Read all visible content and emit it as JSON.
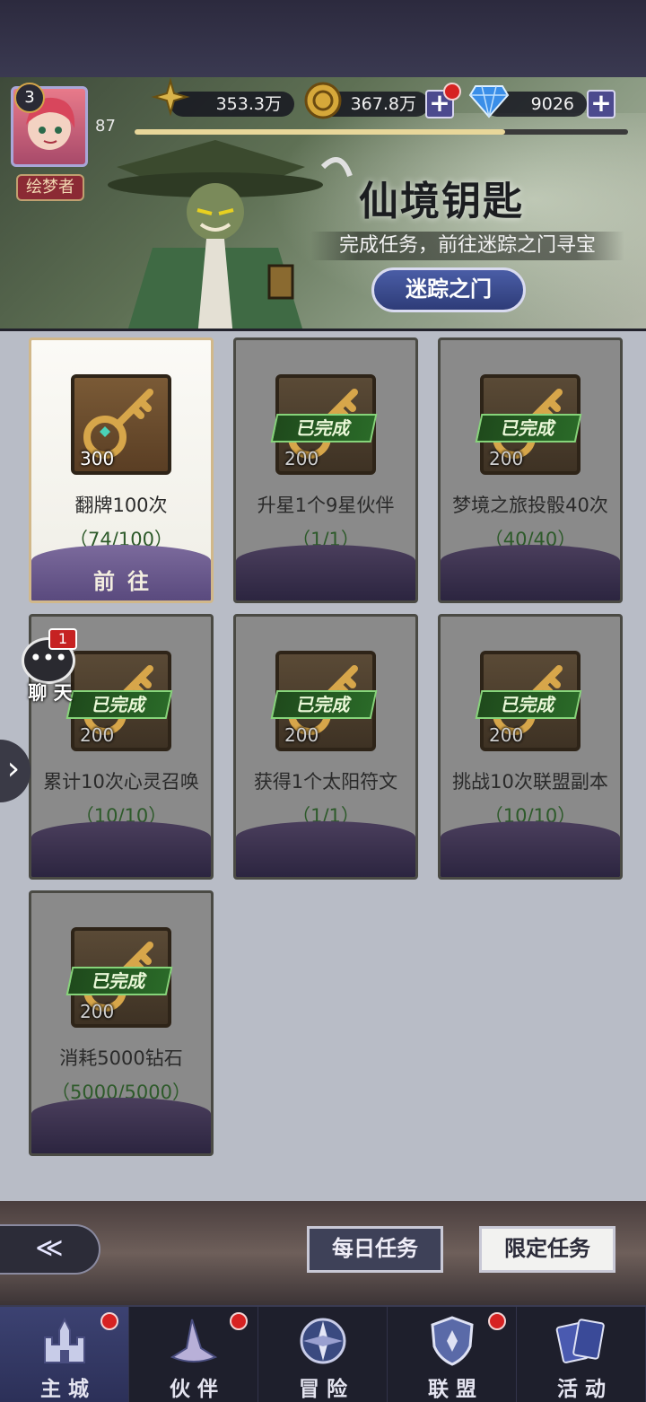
{
  "resources": {
    "power": "353.3万",
    "gold": "367.8万",
    "diamonds": "9026"
  },
  "player": {
    "level_badge": "3",
    "level": "87",
    "title": "绘梦者",
    "xp_fraction": 0.75
  },
  "event": {
    "title": "仙境钥匙",
    "subtitle": "完成任务，前往迷踪之门寻宝",
    "portal_button": "迷踪之门"
  },
  "tasks": [
    {
      "title": "翻牌100次",
      "progress": "（74/100）",
      "reward": "300",
      "status": "active",
      "action": "前往"
    },
    {
      "title": "升星1个9星伙伴",
      "progress": "（1/1）",
      "reward": "200",
      "status": "done",
      "stamp": "已完成"
    },
    {
      "title": "梦境之旅投骰40次",
      "progress": "（40/40）",
      "reward": "200",
      "status": "done",
      "stamp": "已完成"
    },
    {
      "title": "累计10次心灵召唤",
      "progress": "（10/10）",
      "reward": "200",
      "status": "done",
      "stamp": "已完成"
    },
    {
      "title": "获得1个太阳符文",
      "progress": "（1/1）",
      "reward": "200",
      "status": "done",
      "stamp": "已完成"
    },
    {
      "title": "挑战10次联盟副本",
      "progress": "（10/10）",
      "reward": "200",
      "status": "done",
      "stamp": "已完成"
    },
    {
      "title": "消耗5000钻石",
      "progress": "（5000/5000）",
      "reward": "200",
      "status": "done",
      "stamp": "已完成"
    }
  ],
  "chat": {
    "label": "聊 天",
    "badge": "1"
  },
  "task_tabs": {
    "daily": "每日任务",
    "limited": "限定任务"
  },
  "nav": [
    {
      "label": "主城",
      "icon": "castle-icon",
      "active": true,
      "dot": true
    },
    {
      "label": "伙伴",
      "icon": "wizard-hat-icon",
      "active": false,
      "dot": true
    },
    {
      "label": "冒险",
      "icon": "compass-icon",
      "active": false,
      "dot": false
    },
    {
      "label": "联盟",
      "icon": "shield-icon",
      "active": false,
      "dot": true
    },
    {
      "label": "活动",
      "icon": "cards-icon",
      "active": false,
      "dot": false
    }
  ],
  "colors": {
    "accent": "#4a5da6",
    "done_green": "#2a6a28",
    "badge_red": "#d62222"
  }
}
